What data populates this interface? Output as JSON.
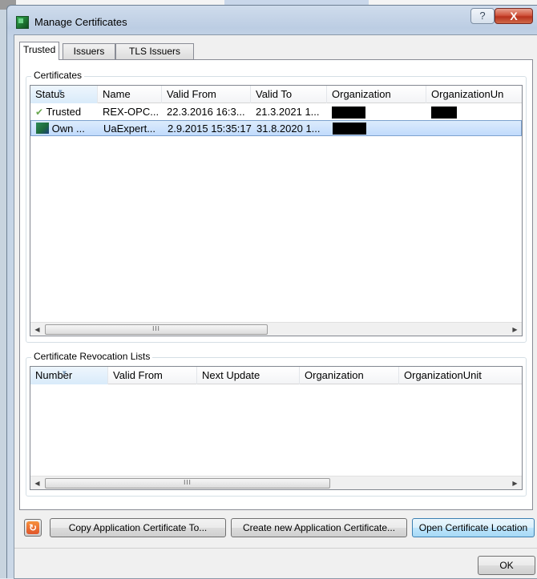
{
  "window": {
    "title": "Manage Certificates",
    "help_glyph": "?",
    "close_glyph": "X"
  },
  "tabs": [
    {
      "label": "Trusted",
      "active": true
    },
    {
      "label": "Issuers",
      "active": false
    },
    {
      "label": "TLS Issuers",
      "active": false
    }
  ],
  "certificates": {
    "group_title": "Certificates",
    "columns": [
      "Status",
      "Name",
      "Valid From",
      "Valid To",
      "Organization",
      "OrganizationUn"
    ],
    "rows": [
      {
        "status_icon": "checkmark-icon",
        "status": "Trusted",
        "name": "REX-OPC...",
        "valid_from": "22.3.2016 16:3...",
        "valid_to": "21.3.2021 1...",
        "organization": "[redacted]",
        "organization_unit": "[redacted]",
        "selected": false
      },
      {
        "status_icon": "certificate-icon",
        "status": "Own ...",
        "name": "UaExpert...",
        "valid_from": "2.9.2015 15:35:17",
        "valid_to": "31.8.2020 1...",
        "organization": "[redacted]",
        "organization_unit": "",
        "selected": true
      }
    ],
    "scroll_thumb": "III"
  },
  "crl": {
    "group_title": "Certificate Revocation Lists",
    "columns": [
      "Number",
      "Valid From",
      "Next Update",
      "Organization",
      "OrganizationUnit"
    ],
    "rows": [],
    "scroll_thumb": "III"
  },
  "buttons": {
    "copy_cert": "Copy Application Certificate To...",
    "create_cert": "Create new Application Certificate...",
    "open_location": "Open Certificate Location",
    "ok": "OK"
  },
  "colors": {
    "accent": "#3c7fb1",
    "selection": "#c1dbfc",
    "close": "#c7432b",
    "trusted_check": "#6aa84f"
  }
}
